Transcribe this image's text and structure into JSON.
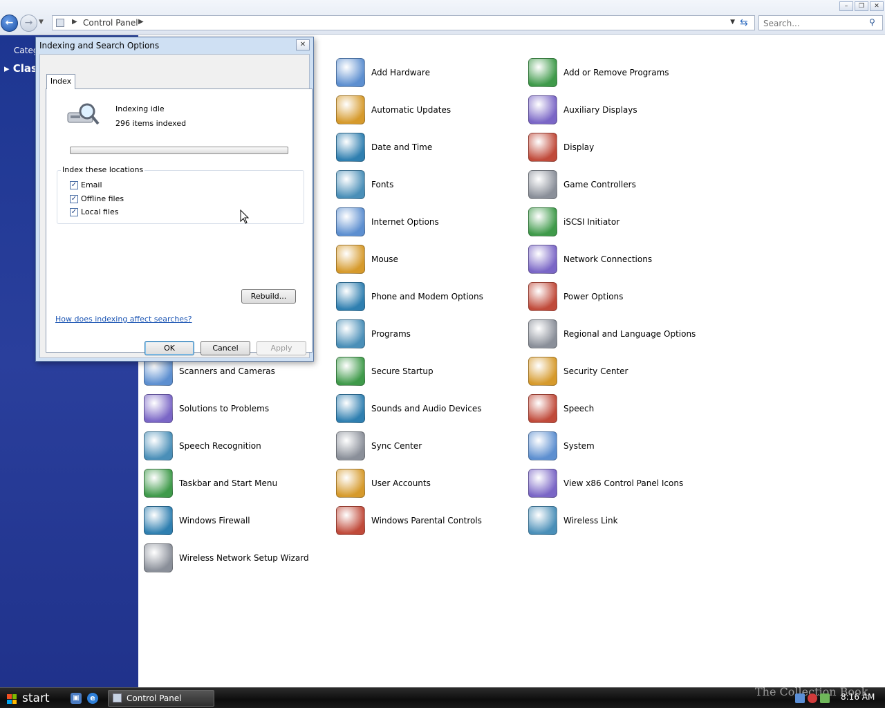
{
  "address_bar": {
    "breadcrumb": "Control Panel",
    "search_placeholder": "Search..."
  },
  "left_pane": {
    "category_view_link": "Categ",
    "classic_view_link": "Clas"
  },
  "control_panel_items": [
    {
      "label": "Add Hardware",
      "icon": "add-hardware-icon"
    },
    {
      "label": "Add or Remove Programs",
      "icon": "add-remove-programs-icon"
    },
    {
      "label": "Automatic Updates",
      "icon": "windows-update-icon"
    },
    {
      "label": "Auxiliary Displays",
      "icon": "auxiliary-display-icon"
    },
    {
      "label": "Date and Time",
      "icon": "clock-calendar-icon"
    },
    {
      "label": "Display",
      "icon": "display-icon"
    },
    {
      "label": "Fonts",
      "icon": "fonts-folder-icon"
    },
    {
      "label": "Game Controllers",
      "icon": "gamepad-icon"
    },
    {
      "label": "Internet Options",
      "icon": "internet-globe-icon"
    },
    {
      "label": "iSCSI Initiator",
      "icon": "globe-network-icon"
    },
    {
      "label": "Mouse",
      "icon": "mouse-icon"
    },
    {
      "label": "Network Connections",
      "icon": "network-globe-icon"
    },
    {
      "label": "Phone and Modem Options",
      "icon": "phone-modem-icon"
    },
    {
      "label": "Power Options",
      "icon": "power-plug-icon"
    },
    {
      "label": "Programs",
      "icon": "programs-icon"
    },
    {
      "label": "Regional and Language Options",
      "icon": "regional-globe-icon"
    },
    {
      "label": "Scanners and Cameras",
      "icon": "scanner-icon"
    },
    {
      "label": "Secure Startup",
      "icon": "keys-icon"
    },
    {
      "label": "Security Center",
      "icon": "security-shield-icon"
    },
    {
      "label": "Solutions to Problems",
      "icon": "solutions-check-icon"
    },
    {
      "label": "Sounds and Audio Devices",
      "icon": "speaker-icon"
    },
    {
      "label": "Speech",
      "icon": "speech-bubble-icon"
    },
    {
      "label": "Speech Recognition",
      "icon": "speech-recognition-icon"
    },
    {
      "label": "Sync Center",
      "icon": "sync-arrows-icon"
    },
    {
      "label": "System",
      "icon": "system-computer-icon"
    },
    {
      "label": "Taskbar and Start Menu",
      "icon": "taskbar-icon"
    },
    {
      "label": "User Accounts",
      "icon": "users-icon"
    },
    {
      "label": "View x86 Control Panel Icons",
      "icon": "x86-panel-icon"
    },
    {
      "label": "Windows Firewall",
      "icon": "firewall-brick-icon"
    },
    {
      "label": "Windows Parental Controls",
      "icon": "parental-lock-icon"
    },
    {
      "label": "Wireless Link",
      "icon": "wireless-link-icon"
    },
    {
      "label": "Wireless Network Setup Wizard",
      "icon": "wireless-usb-icon"
    }
  ],
  "dialog": {
    "title": "Indexing and Search Options",
    "tab": "Index",
    "status": "Indexing idle",
    "items_indexed": "296 items indexed",
    "locations_legend": "Index these locations",
    "locations": [
      {
        "label": "Email",
        "checked": true
      },
      {
        "label": "Offline files",
        "checked": true
      },
      {
        "label": "Local files",
        "checked": true
      }
    ],
    "rebuild_button": "Rebuild...",
    "help_link": "How does indexing affect searches?",
    "ok_button": "OK",
    "cancel_button": "Cancel",
    "apply_button": "Apply"
  },
  "taskbar": {
    "start_label": "start",
    "task_button": "Control Panel",
    "watermark": "The Collection Book",
    "clock": "8:16 AM"
  },
  "colors": {
    "left_pane": "#22368f",
    "link": "#1d56b4",
    "taskbar": "#1a1a1a"
  }
}
